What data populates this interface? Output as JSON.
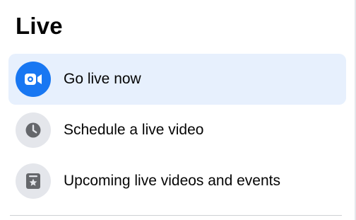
{
  "page": {
    "title": "Live"
  },
  "menu": {
    "items": [
      {
        "label": "Go live now",
        "icon": "video-camera-icon",
        "active": true
      },
      {
        "label": "Schedule a live video",
        "icon": "clock-icon",
        "active": false
      },
      {
        "label": "Upcoming live videos and events",
        "icon": "calendar-star-icon",
        "active": false
      }
    ]
  },
  "colors": {
    "accent": "#1877f2",
    "active_background": "#e7f0fd",
    "icon_background": "#e4e6eb",
    "icon_glyph": "#65676b",
    "text": "#050505",
    "divider": "#ced0d4"
  }
}
